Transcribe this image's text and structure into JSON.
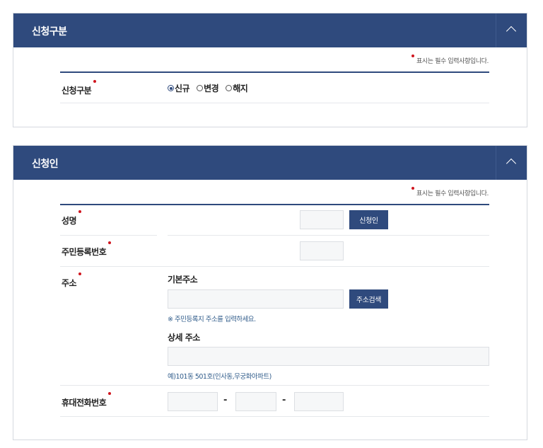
{
  "sections": {
    "type": {
      "title": "신청구분",
      "required_note": "표시는 필수 입력사항입니다.",
      "field_label": "신청구분",
      "options": [
        "신규",
        "변경",
        "해지"
      ],
      "selected": "신규"
    },
    "applicant": {
      "title": "신청인",
      "required_note": "표시는 필수 입력사항입니다.",
      "name_label": "성명",
      "applicant_button": "신청인",
      "resident_label": "주민등록번호",
      "address_label": "주소",
      "basic_address_label": "기본주소",
      "address_search_button": "주소검색",
      "address_hint": "※ 주민등록지 주소를 입력하세요.",
      "detail_address_label": "상세 주소",
      "detail_hint": "예)101동 501호(인사동,무궁화아파트)",
      "phone_label": "휴대전화번호",
      "phone_separator": "-"
    }
  },
  "colors": {
    "header_bg": "#2f4a7d",
    "required_dot": "#d0161f",
    "hint_text": "#2f5b8a"
  }
}
